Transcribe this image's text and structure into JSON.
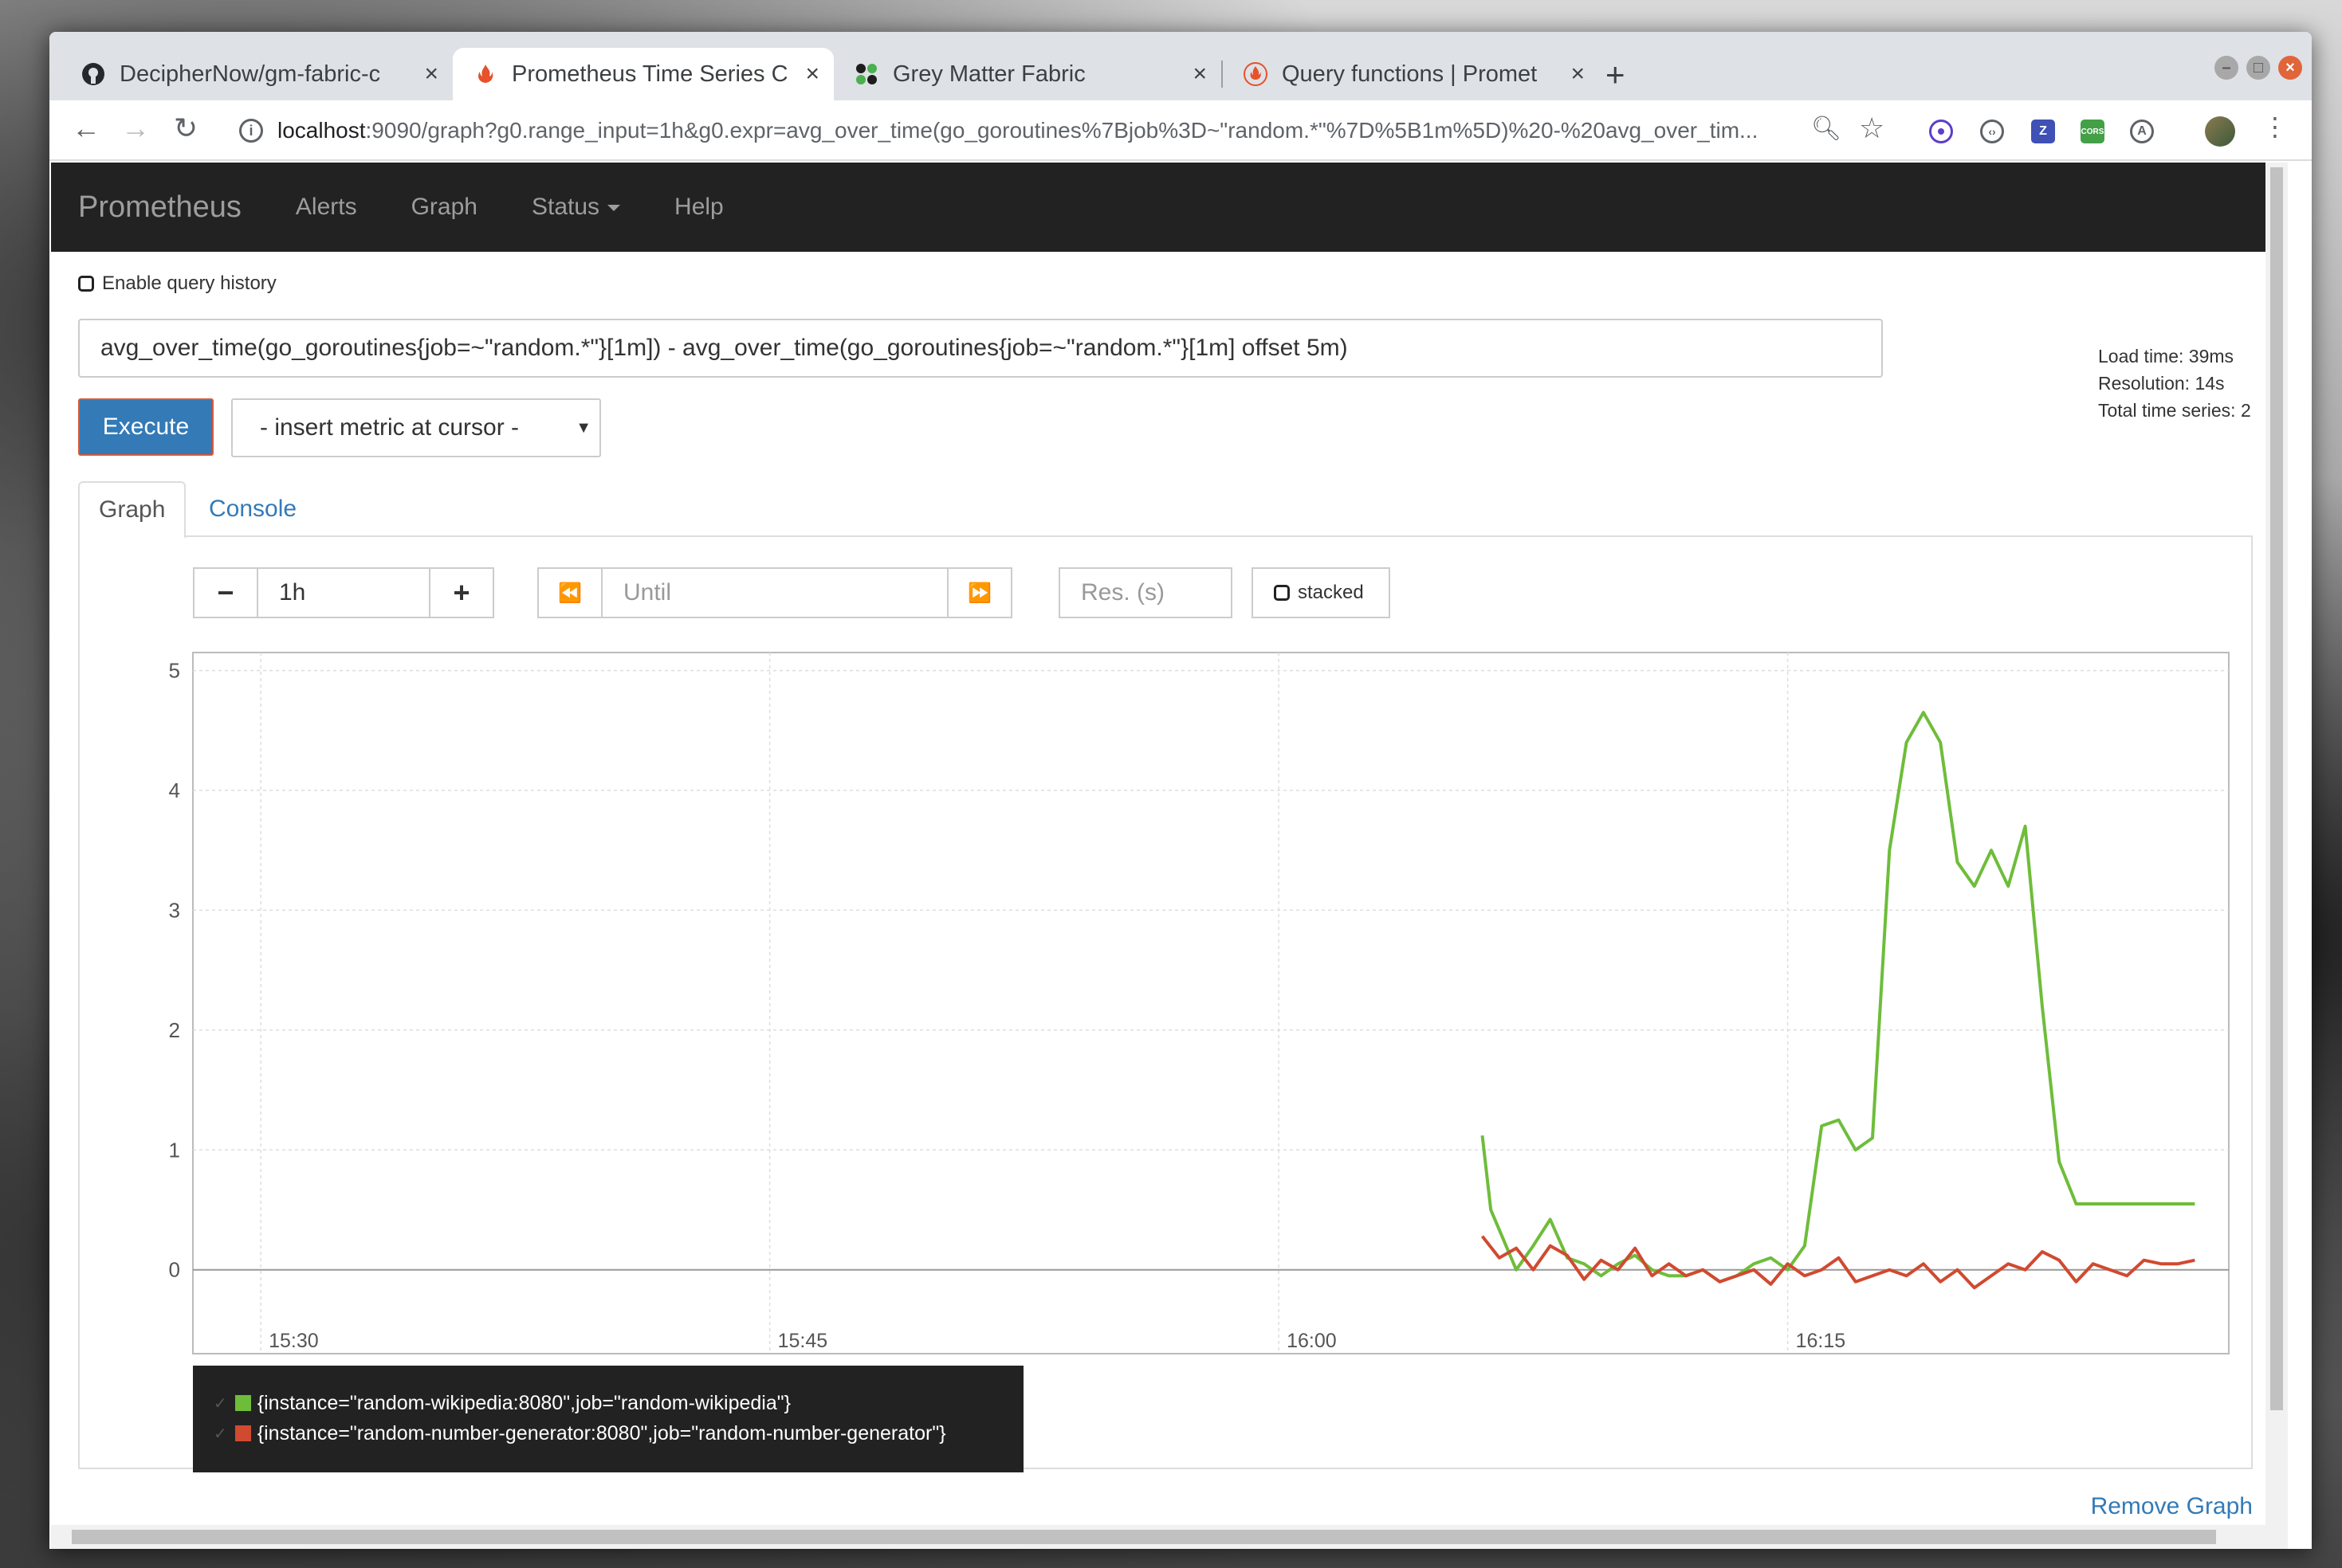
{
  "browser": {
    "tabs": [
      {
        "title": "DecipherNow/gm-fabric-c",
        "favicon": "github-icon"
      },
      {
        "title": "Prometheus Time Series C",
        "favicon": "prometheus-icon"
      },
      {
        "title": "Grey Matter Fabric",
        "favicon": "greymatter-icon"
      },
      {
        "title": "Query functions | Promet",
        "favicon": "prometheus-icon"
      }
    ],
    "close_glyph": "×",
    "new_tab_glyph": "+",
    "url_host": "localhost",
    "url_rest": ":9090/graph?g0.range_input=1h&g0.expr=avg_over_time(go_goroutines%7Bjob%3D~\"random.*\"%7D%5B1m%5D)%20-%20avg_over_tim...",
    "extensions": [
      "target-icon",
      "code-icon",
      "z-icon",
      "cors-icon",
      "a-icon"
    ],
    "extension_labels": {
      "z": "Z",
      "cors": "CORS",
      "a": "A"
    }
  },
  "nav": {
    "brand": "Prometheus",
    "links": [
      "Alerts",
      "Graph",
      "Status",
      "Help"
    ]
  },
  "query": {
    "history_label": "Enable query history",
    "expression": "avg_over_time(go_goroutines{job=~\"random.*\"}[1m]) - avg_over_time(go_goroutines{job=~\"random.*\"}[1m] offset 5m)",
    "execute_label": "Execute",
    "insert_metric_label": "- insert metric at cursor -",
    "load_time": "Load time: 39ms",
    "resolution": "Resolution: 14s",
    "total_series": "Total time series: 2"
  },
  "tabs": {
    "graph": "Graph",
    "console": "Console"
  },
  "graph_controls": {
    "minus": "−",
    "range": "1h",
    "plus": "+",
    "back": "⏪",
    "until_placeholder": "Until",
    "forward": "⏩",
    "res_placeholder": "Res. (s)",
    "stacked_label": "stacked"
  },
  "remove_graph": "Remove Graph",
  "colors": {
    "green": "#6ebd3a",
    "red": "#d04a30",
    "accent": "#337ab7"
  },
  "chart_data": {
    "type": "line",
    "title": "",
    "xlabel": "",
    "ylabel": "",
    "ylim": [
      -0.7,
      5.15
    ],
    "xlim": [
      "15:28",
      "16:28"
    ],
    "yticks": [
      0,
      1,
      2,
      3,
      4,
      5
    ],
    "xticks": [
      "15:30",
      "15:45",
      "16:00",
      "16:15"
    ],
    "grid": true,
    "legend": "bottom-left",
    "series": [
      {
        "name": "{instance=\"random-wikipedia:8080\",job=\"random-wikipedia\"}",
        "color": "#6ebd3a",
        "x": [
          "16:06:00",
          "16:06:15",
          "16:07:00",
          "16:07:30",
          "16:08:00",
          "16:08:30",
          "16:09:00",
          "16:09:30",
          "16:10:00",
          "16:10:30",
          "16:11:00",
          "16:11:30",
          "16:12:00",
          "16:12:30",
          "16:13:00",
          "16:13:30",
          "16:14:00",
          "16:14:30",
          "16:15:00",
          "16:15:30",
          "16:16:00",
          "16:16:30",
          "16:17:00",
          "16:17:30",
          "16:18:00",
          "16:18:30",
          "16:19:00",
          "16:19:30",
          "16:20:00",
          "16:20:30",
          "16:21:00",
          "16:21:30",
          "16:22:00",
          "16:22:30",
          "16:23:00",
          "16:23:30",
          "16:24:00",
          "16:24:30",
          "16:25:00",
          "16:25:30",
          "16:26:00",
          "16:26:30",
          "16:27:00"
        ],
        "y": [
          1.12,
          0.5,
          0.0,
          0.2,
          0.42,
          0.1,
          0.05,
          -0.05,
          0.05,
          0.12,
          0.0,
          -0.05,
          -0.05,
          0.0,
          -0.1,
          -0.05,
          0.05,
          0.1,
          0.0,
          0.2,
          1.2,
          1.25,
          1.0,
          1.1,
          3.5,
          4.4,
          4.65,
          4.4,
          3.4,
          3.2,
          3.5,
          3.2,
          3.7,
          2.2,
          0.9,
          0.55,
          0.55,
          0.55,
          0.55,
          0.55,
          0.55,
          0.55,
          0.55
        ],
        "values_note": ""
      },
      {
        "name": "{instance=\"random-number-generator:8080\",job=\"random-number-generator\"}",
        "color": "#d04a30",
        "x": [
          "16:06:00",
          "16:06:30",
          "16:07:00",
          "16:07:30",
          "16:08:00",
          "16:08:30",
          "16:09:00",
          "16:09:30",
          "16:10:00",
          "16:10:30",
          "16:11:00",
          "16:11:30",
          "16:12:00",
          "16:12:30",
          "16:13:00",
          "16:13:30",
          "16:14:00",
          "16:14:30",
          "16:15:00",
          "16:15:30",
          "16:16:00",
          "16:16:30",
          "16:17:00",
          "16:17:30",
          "16:18:00",
          "16:18:30",
          "16:19:00",
          "16:19:30",
          "16:20:00",
          "16:20:30",
          "16:21:00",
          "16:21:30",
          "16:22:00",
          "16:22:30",
          "16:23:00",
          "16:23:30",
          "16:24:00",
          "16:24:30",
          "16:25:00",
          "16:25:30",
          "16:26:00",
          "16:26:30",
          "16:27:00"
        ],
        "y": [
          0.28,
          0.1,
          0.18,
          0.0,
          0.2,
          0.12,
          -0.08,
          0.08,
          0.0,
          0.18,
          -0.05,
          0.05,
          -0.05,
          0.0,
          -0.1,
          -0.05,
          0.0,
          -0.12,
          0.05,
          -0.05,
          0.0,
          0.1,
          -0.1,
          -0.05,
          0.0,
          -0.05,
          0.05,
          -0.1,
          0.0,
          -0.15,
          -0.05,
          0.05,
          0.0,
          0.15,
          0.08,
          -0.1,
          0.05,
          0.0,
          -0.05,
          0.08,
          0.05,
          0.05,
          0.08
        ]
      }
    ]
  }
}
